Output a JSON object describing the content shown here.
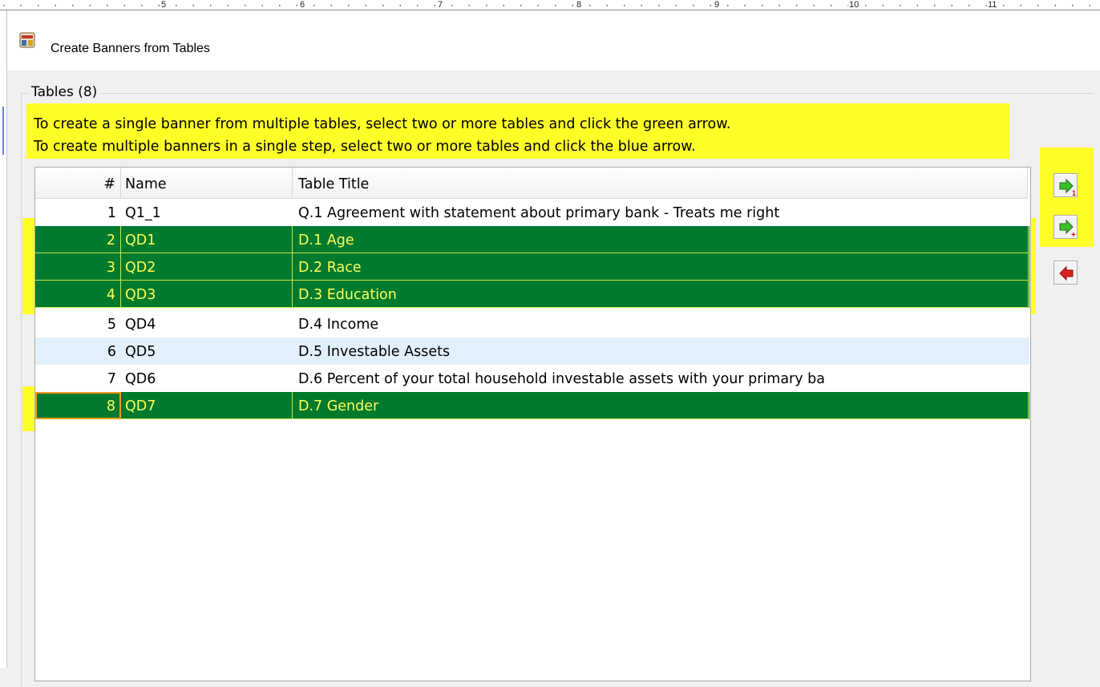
{
  "ruler": {
    "numbers": [
      "5",
      "6",
      "7",
      "8",
      "9",
      "10",
      "11"
    ]
  },
  "window": {
    "title": "Create Banners from Tables",
    "icon": "banner-app-icon"
  },
  "group": {
    "legend": "Tables (8)",
    "instructions": [
      "To create a single banner from multiple tables, select two or more tables and click the green arrow.",
      "To create multiple banners in a single step, select two or more tables and click the blue arrow."
    ]
  },
  "table": {
    "columns": {
      "num": "#",
      "name": "Name",
      "title": "Table Title"
    },
    "rows": [
      {
        "num": "1",
        "name": "Q1_1",
        "title": "Q.1  Agreement with statement about primary bank - Treats me right",
        "selected": false
      },
      {
        "num": "2",
        "name": "QD1",
        "title": "D.1  Age",
        "selected": true
      },
      {
        "num": "3",
        "name": "QD2",
        "title": "D.2  Race",
        "selected": true
      },
      {
        "num": "4",
        "name": "QD3",
        "title": "D.3  Education",
        "selected": true
      },
      {
        "num": "5",
        "name": "QD4",
        "title": "D.4  Income",
        "selected": false
      },
      {
        "num": "6",
        "name": "QD5",
        "title": "D.5  Investable Assets",
        "selected": false
      },
      {
        "num": "7",
        "name": "QD6",
        "title": "D.6  Percent of your total household investable assets with your primary ba",
        "selected": false
      },
      {
        "num": "8",
        "name": "QD7",
        "title": "D.7  Gender",
        "selected": true
      }
    ]
  },
  "toolbar": [
    {
      "icon": "green-arrow-right-1-icon"
    },
    {
      "icon": "green-arrow-right-plus-icon"
    },
    {
      "icon": "red-arrow-left-icon"
    }
  ],
  "colors": {
    "highlight": "#ffff28",
    "selected_row_bg": "#007a2c",
    "selected_row_text": "#ffff5a",
    "alt_row_bg": "#e2f0fb",
    "focus_outline": "#ff9a1a"
  }
}
